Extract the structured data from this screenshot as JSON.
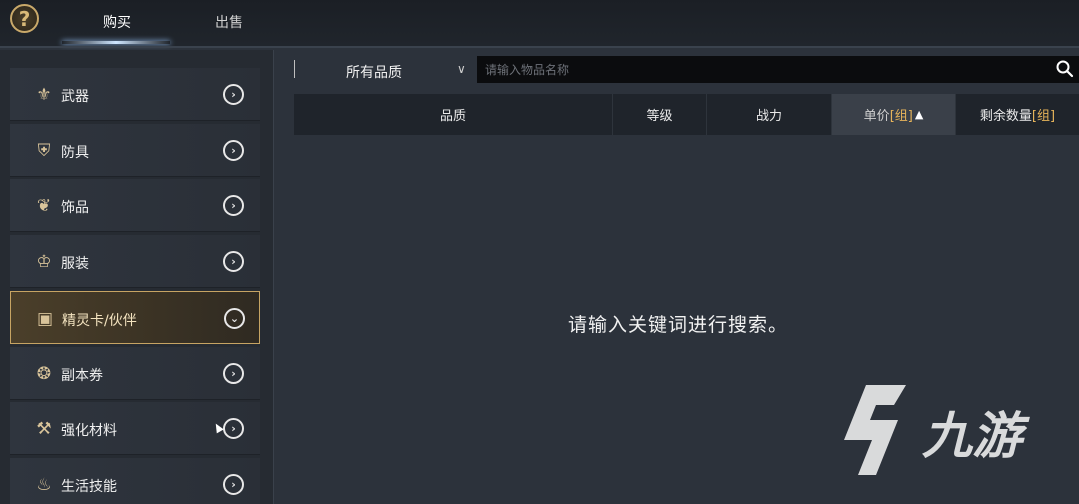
{
  "tabs": [
    {
      "label": "购买",
      "active": true
    },
    {
      "label": "出售",
      "active": false
    }
  ],
  "help_icon": "question-mark-icon",
  "categories": [
    {
      "label": "武器",
      "icon": "weapon-icon"
    },
    {
      "label": "防具",
      "icon": "armor-icon"
    },
    {
      "label": "饰品",
      "icon": "accessory-icon"
    },
    {
      "label": "服装",
      "icon": "clothing-icon"
    },
    {
      "label": "精灵卡/伙伴",
      "icon": "card-icon",
      "active": true
    },
    {
      "label": "副本券",
      "icon": "ticket-icon"
    },
    {
      "label": "强化材料",
      "icon": "material-icon"
    },
    {
      "label": "生活技能",
      "icon": "life-skill-icon"
    }
  ],
  "filter": {
    "quality_selected": "所有品质",
    "search_placeholder": "请输入物品名称"
  },
  "table_header": {
    "quality": "品质",
    "level": "等级",
    "power": "战力",
    "unit_price": "单价",
    "unit_price_bracket": "[组]",
    "remaining": "剩余数量",
    "remaining_bracket": "[组]"
  },
  "empty_message": "请输入关键词进行搜索。",
  "watermark": "九游",
  "colors": {
    "accent_gold": "#c7a463",
    "bracket_gold": "#e7b45a",
    "background": "#2c323b"
  }
}
